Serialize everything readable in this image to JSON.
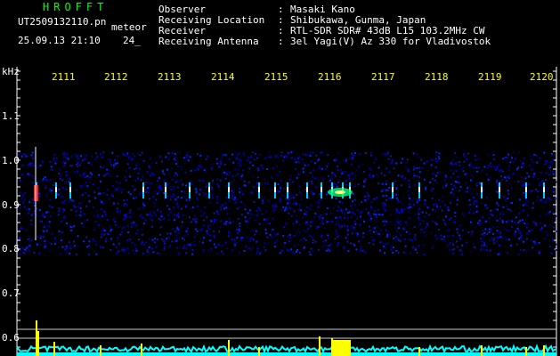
{
  "colors": {
    "white": "#ffffff",
    "yellow": "#ffff00",
    "green": "#00ff00",
    "cyan": "#00ffff",
    "background": "#000000"
  },
  "header": {
    "title": "HROFFT",
    "filename": "UT2509132110.pn",
    "filename_suffix": "meteor",
    "timestamp": "25.09.13 21:10",
    "timestamp_extra": "24_"
  },
  "meta": [
    {
      "key": "Observer",
      "value": "Masaki Kano"
    },
    {
      "key": "Receiving Location",
      "value": "Shibukawa, Gunma, Japan"
    },
    {
      "key": "Receiver",
      "value": "RTL-SDR SDR# 43dB L15 103.2MHz CW"
    },
    {
      "key": "Receiving Antenna",
      "value": "3el Yagi(V) Az 330 for Vladivostok"
    }
  ],
  "meta_sep": ":",
  "axis": {
    "y_unit": "kHz",
    "y_ticks": [
      "1.1",
      "1.0",
      "0.9",
      "0.8",
      "0.7",
      "0.6"
    ],
    "x_ticks": [
      "2111",
      "2112",
      "2113",
      "2114",
      "2115",
      "2116",
      "2117",
      "2118",
      "2119",
      "2120"
    ]
  }
}
